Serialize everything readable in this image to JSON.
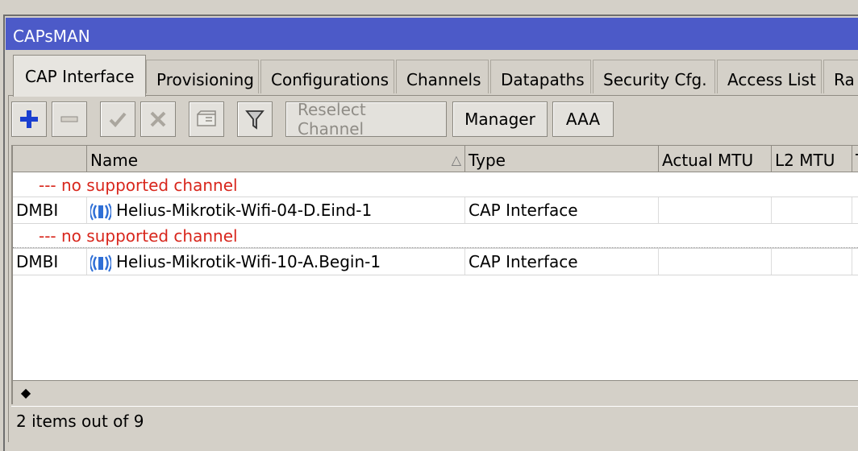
{
  "window": {
    "title": "CAPsMAN"
  },
  "tabs": [
    {
      "label": "CAP Interface",
      "active": true
    },
    {
      "label": "Provisioning"
    },
    {
      "label": "Configurations"
    },
    {
      "label": "Channels"
    },
    {
      "label": "Datapaths"
    },
    {
      "label": "Security Cfg."
    },
    {
      "label": "Access List"
    },
    {
      "label": "Ra"
    }
  ],
  "toolbar": {
    "add_icon": "plus-icon",
    "remove_icon": "minus-icon",
    "enable_icon": "check-icon",
    "disable_icon": "x-icon",
    "comment_icon": "comment-icon",
    "filter_icon": "filter-icon",
    "reselect_label": "Reselect Channel",
    "manager_label": "Manager",
    "aaa_label": "AAA"
  },
  "table": {
    "columns": [
      "",
      "Name",
      "Type",
      "Actual MTU",
      "L2 MTU",
      "T"
    ],
    "sort_indicator": "△",
    "rows": [
      {
        "kind": "message",
        "text": "--- no supported channel"
      },
      {
        "kind": "data",
        "flags": "DMBI",
        "name": "Helius-Mikrotik-Wifi-04-D.Eind-1",
        "type": "CAP Interface",
        "actual_mtu": "",
        "l2_mtu": ""
      },
      {
        "kind": "message",
        "text": "--- no supported channel"
      },
      {
        "kind": "data",
        "flags": "DMBI",
        "name": "Helius-Mikrotik-Wifi-10-A.Begin-1",
        "type": "CAP Interface",
        "actual_mtu": "",
        "l2_mtu": ""
      }
    ]
  },
  "scrollbar": {
    "left_arrow": "◆"
  },
  "status": {
    "text": "2 items out of 9"
  },
  "colors": {
    "titlebar": "#4c5ac8",
    "error_text": "#d8261c",
    "add_icon": "#1a3fd0",
    "interface_icon": "#2f6fd6"
  }
}
